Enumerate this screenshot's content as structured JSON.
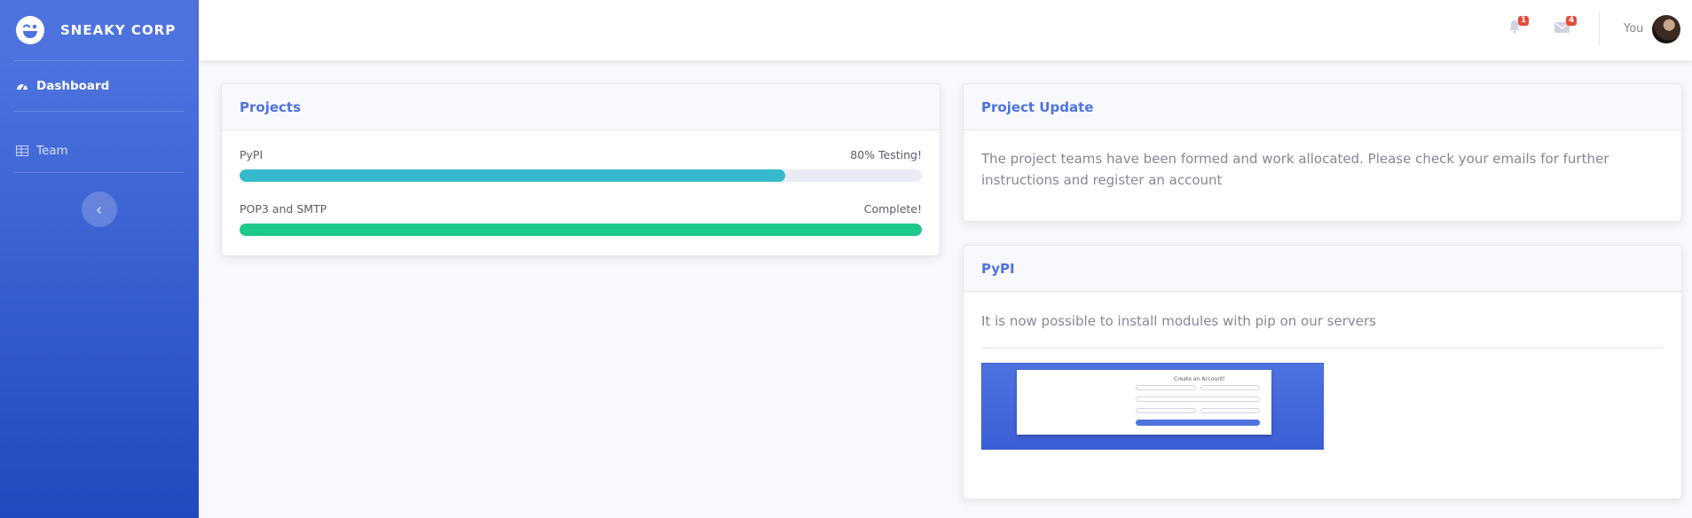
{
  "sidebar": {
    "brand": "SNEAKY CORP",
    "items": [
      {
        "label": "Dashboard",
        "icon": "tachometer-icon",
        "active": true
      },
      {
        "label": "Team",
        "icon": "table-icon",
        "active": false
      }
    ],
    "toggle_icon": "chevron-left-icon"
  },
  "topbar": {
    "alerts_count": "1",
    "messages_count": "4",
    "user_name": "You"
  },
  "projects_card": {
    "title": "Projects",
    "items": [
      {
        "name": "PyPI",
        "status": "80% Testing!",
        "progress": 80,
        "color": "#36b9cc"
      },
      {
        "name": "POP3 and SMTP",
        "status": "Complete!",
        "progress": 100,
        "color": "#1cc88a"
      }
    ]
  },
  "update_card": {
    "title": "Project Update",
    "text": "The project teams have been formed and work allocated. Please check your emails for further instructions and register an account"
  },
  "pypi_card": {
    "title": "PyPI",
    "text": "It is now possible to install modules with pip on our servers",
    "image_title": "Create an Account!"
  },
  "colors": {
    "primary": "#4e73df",
    "info": "#36b9cc",
    "success": "#1cc88a",
    "danger": "#e74a3b"
  }
}
